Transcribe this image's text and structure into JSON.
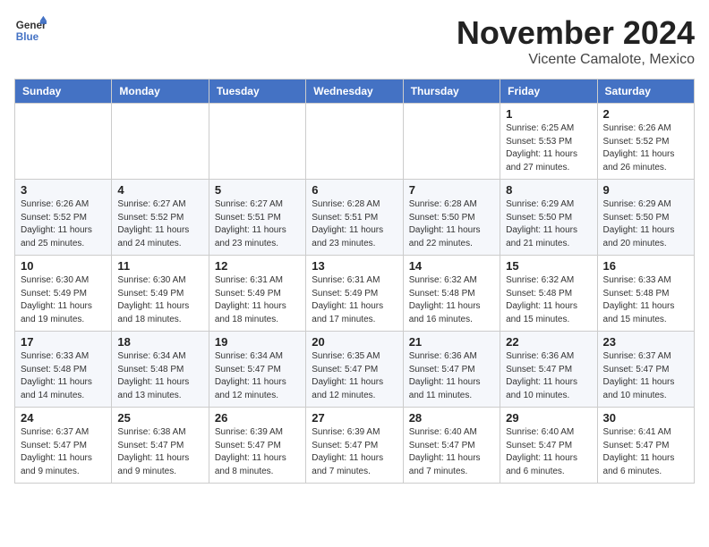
{
  "logo": {
    "general": "General",
    "blue": "Blue"
  },
  "header": {
    "month": "November 2024",
    "location": "Vicente Camalote, Mexico"
  },
  "weekdays": [
    "Sunday",
    "Monday",
    "Tuesday",
    "Wednesday",
    "Thursday",
    "Friday",
    "Saturday"
  ],
  "weeks": [
    [
      {
        "day": "",
        "detail": ""
      },
      {
        "day": "",
        "detail": ""
      },
      {
        "day": "",
        "detail": ""
      },
      {
        "day": "",
        "detail": ""
      },
      {
        "day": "",
        "detail": ""
      },
      {
        "day": "1",
        "detail": "Sunrise: 6:25 AM\nSunset: 5:53 PM\nDaylight: 11 hours and 27 minutes."
      },
      {
        "day": "2",
        "detail": "Sunrise: 6:26 AM\nSunset: 5:52 PM\nDaylight: 11 hours and 26 minutes."
      }
    ],
    [
      {
        "day": "3",
        "detail": "Sunrise: 6:26 AM\nSunset: 5:52 PM\nDaylight: 11 hours and 25 minutes."
      },
      {
        "day": "4",
        "detail": "Sunrise: 6:27 AM\nSunset: 5:52 PM\nDaylight: 11 hours and 24 minutes."
      },
      {
        "day": "5",
        "detail": "Sunrise: 6:27 AM\nSunset: 5:51 PM\nDaylight: 11 hours and 23 minutes."
      },
      {
        "day": "6",
        "detail": "Sunrise: 6:28 AM\nSunset: 5:51 PM\nDaylight: 11 hours and 23 minutes."
      },
      {
        "day": "7",
        "detail": "Sunrise: 6:28 AM\nSunset: 5:50 PM\nDaylight: 11 hours and 22 minutes."
      },
      {
        "day": "8",
        "detail": "Sunrise: 6:29 AM\nSunset: 5:50 PM\nDaylight: 11 hours and 21 minutes."
      },
      {
        "day": "9",
        "detail": "Sunrise: 6:29 AM\nSunset: 5:50 PM\nDaylight: 11 hours and 20 minutes."
      }
    ],
    [
      {
        "day": "10",
        "detail": "Sunrise: 6:30 AM\nSunset: 5:49 PM\nDaylight: 11 hours and 19 minutes."
      },
      {
        "day": "11",
        "detail": "Sunrise: 6:30 AM\nSunset: 5:49 PM\nDaylight: 11 hours and 18 minutes."
      },
      {
        "day": "12",
        "detail": "Sunrise: 6:31 AM\nSunset: 5:49 PM\nDaylight: 11 hours and 18 minutes."
      },
      {
        "day": "13",
        "detail": "Sunrise: 6:31 AM\nSunset: 5:49 PM\nDaylight: 11 hours and 17 minutes."
      },
      {
        "day": "14",
        "detail": "Sunrise: 6:32 AM\nSunset: 5:48 PM\nDaylight: 11 hours and 16 minutes."
      },
      {
        "day": "15",
        "detail": "Sunrise: 6:32 AM\nSunset: 5:48 PM\nDaylight: 11 hours and 15 minutes."
      },
      {
        "day": "16",
        "detail": "Sunrise: 6:33 AM\nSunset: 5:48 PM\nDaylight: 11 hours and 15 minutes."
      }
    ],
    [
      {
        "day": "17",
        "detail": "Sunrise: 6:33 AM\nSunset: 5:48 PM\nDaylight: 11 hours and 14 minutes."
      },
      {
        "day": "18",
        "detail": "Sunrise: 6:34 AM\nSunset: 5:48 PM\nDaylight: 11 hours and 13 minutes."
      },
      {
        "day": "19",
        "detail": "Sunrise: 6:34 AM\nSunset: 5:47 PM\nDaylight: 11 hours and 12 minutes."
      },
      {
        "day": "20",
        "detail": "Sunrise: 6:35 AM\nSunset: 5:47 PM\nDaylight: 11 hours and 12 minutes."
      },
      {
        "day": "21",
        "detail": "Sunrise: 6:36 AM\nSunset: 5:47 PM\nDaylight: 11 hours and 11 minutes."
      },
      {
        "day": "22",
        "detail": "Sunrise: 6:36 AM\nSunset: 5:47 PM\nDaylight: 11 hours and 10 minutes."
      },
      {
        "day": "23",
        "detail": "Sunrise: 6:37 AM\nSunset: 5:47 PM\nDaylight: 11 hours and 10 minutes."
      }
    ],
    [
      {
        "day": "24",
        "detail": "Sunrise: 6:37 AM\nSunset: 5:47 PM\nDaylight: 11 hours and 9 minutes."
      },
      {
        "day": "25",
        "detail": "Sunrise: 6:38 AM\nSunset: 5:47 PM\nDaylight: 11 hours and 9 minutes."
      },
      {
        "day": "26",
        "detail": "Sunrise: 6:39 AM\nSunset: 5:47 PM\nDaylight: 11 hours and 8 minutes."
      },
      {
        "day": "27",
        "detail": "Sunrise: 6:39 AM\nSunset: 5:47 PM\nDaylight: 11 hours and 7 minutes."
      },
      {
        "day": "28",
        "detail": "Sunrise: 6:40 AM\nSunset: 5:47 PM\nDaylight: 11 hours and 7 minutes."
      },
      {
        "day": "29",
        "detail": "Sunrise: 6:40 AM\nSunset: 5:47 PM\nDaylight: 11 hours and 6 minutes."
      },
      {
        "day": "30",
        "detail": "Sunrise: 6:41 AM\nSunset: 5:47 PM\nDaylight: 11 hours and 6 minutes."
      }
    ]
  ]
}
